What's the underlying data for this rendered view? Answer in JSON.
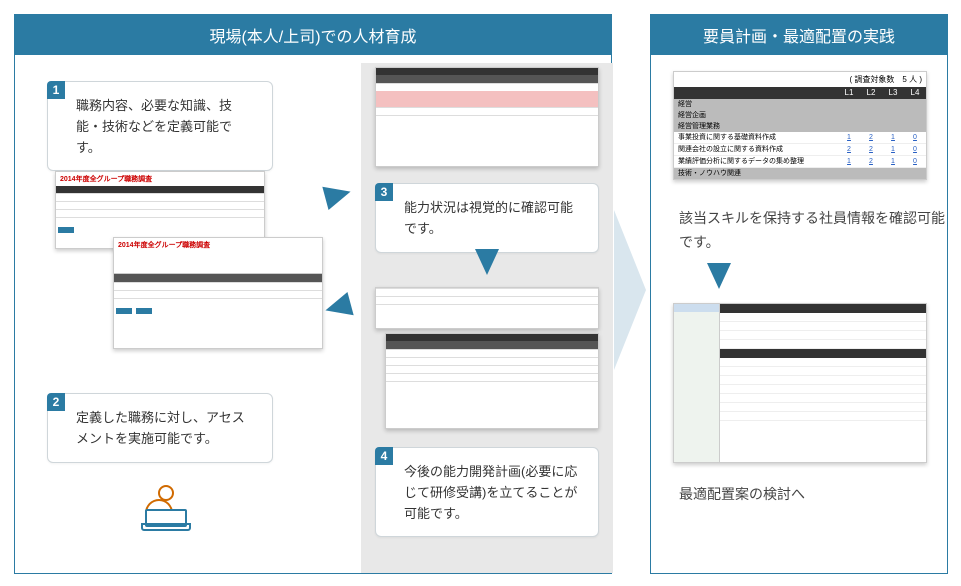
{
  "left_header": "現場(本人/上司)での人材育成",
  "right_header": "要員計画・最適配置の実践",
  "bubbles": {
    "b1": {
      "num": "1",
      "text": "職務内容、必要な知識、技能・技術などを定義可能です。"
    },
    "b2": {
      "num": "2",
      "text": "定義した職務に対し、アセスメントを実施可能です。"
    },
    "b3": {
      "num": "3",
      "text": "能力状況は視覚的に確認可能です。"
    },
    "b4": {
      "num": "4",
      "text": "今後の能力開発計画(必要に応じて研修受講)を立てることが可能です。"
    }
  },
  "thumb_title": "2014年度全グループ職務調査",
  "right_table": {
    "header_note": "( 調査対象数　5 人 )",
    "cols": [
      "L1",
      "L2",
      "L3",
      "L4"
    ],
    "cat1": "経営",
    "sub1": "経営企画",
    "sub2": "経営管理業務",
    "rows": [
      {
        "label": "事業投資に関する基礎資料作成",
        "vals": [
          "1",
          "2",
          "1",
          "0"
        ]
      },
      {
        "label": "関連会社の設立に関する資料作成",
        "vals": [
          "2",
          "2",
          "1",
          "0"
        ]
      },
      {
        "label": "業績評価分析に関するデータの集め整理",
        "vals": [
          "1",
          "2",
          "1",
          "0"
        ]
      }
    ],
    "sub3": "技術・ノウハウ関連"
  },
  "right_text1": "該当スキルを保持する社員情報を確認可能です。",
  "right_text2": "最適配置案の検討へ"
}
